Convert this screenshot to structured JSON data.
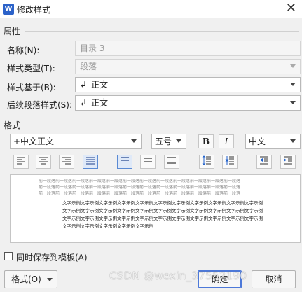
{
  "window": {
    "app_icon_letter": "W",
    "title": "修改样式",
    "close_glyph": "✕"
  },
  "properties": {
    "section_label": "属性",
    "name_label": "名称(N):",
    "name_value": "目录 3",
    "type_label": "样式类型(T):",
    "type_value": "段落",
    "based_on_label": "样式基于(B):",
    "based_on_value": "正文",
    "next_label": "后续段落样式(S):",
    "next_value": "正文"
  },
  "format": {
    "section_label": "格式",
    "font_value": "+中文正文",
    "size_value": "五号",
    "bold_glyph": "B",
    "italic_glyph": "I",
    "lang_value": "中文"
  },
  "preview": {
    "prev_paragraph_char": "前一段落",
    "sample_char": "文字示例"
  },
  "footer": {
    "checkbox_label": "同时保存到模板(A)",
    "format_button": "格式(O)",
    "ok_button": "确定",
    "cancel_button": "取消",
    "watermark": "CSDN @wexin_37552190"
  }
}
